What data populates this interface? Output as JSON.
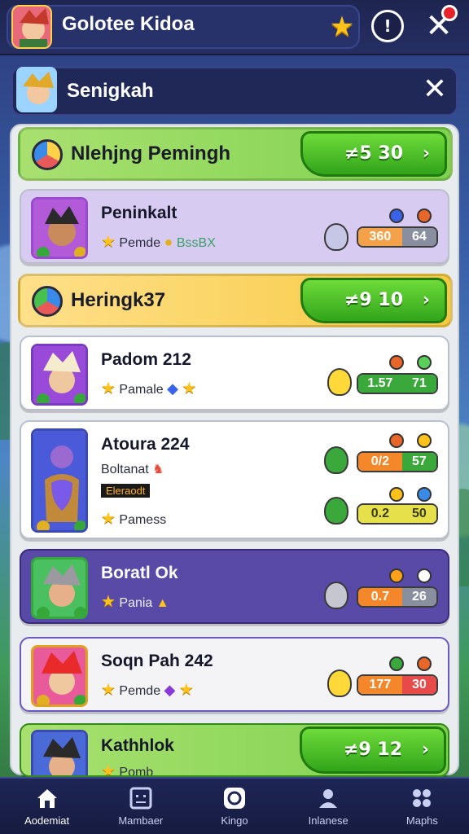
{
  "header": {
    "title": "Golotee Kidoa",
    "icons": [
      "star-icon",
      "info-icon",
      "close-icon"
    ]
  },
  "subheader": {
    "title": "Senigkah"
  },
  "sections": [
    {
      "label": "Nlehjng Pemingh",
      "button": "≠5 30",
      "chevron": "›",
      "color": "#7fd24f"
    },
    {
      "label": "Heringk37",
      "button": "≠9 10",
      "chevron": "›",
      "color": "#f6c940"
    },
    {
      "label": "Kathhlok",
      "button": "≠9 12",
      "chevron": "›",
      "color": "#7fd24f"
    }
  ],
  "cards": [
    {
      "name": "Peninkalt",
      "sub1": "Pemde",
      "sub1b": "BssBX",
      "stat_a": "360",
      "stat_b": "64",
      "mini_a": "ʔ",
      "bg": "#d8cbf2"
    },
    {
      "name": "Padom 212",
      "sub1": "Pamale",
      "stat_a": "1.57",
      "stat_b": "71",
      "bg": "#ffffff"
    },
    {
      "name": "Atoura 224",
      "sub1": "Boltanat",
      "tag": "Eleraodt",
      "sub2": "Pamess",
      "stat_a": "0/2",
      "stat_b": "57",
      "stat_c": "0.2",
      "stat_d": "50",
      "bg": "#ffffff"
    },
    {
      "name": "Boratl Ok",
      "sub1": "Pania",
      "stat_a": "0.7",
      "stat_b": "26",
      "bg": "#5a4aa8"
    },
    {
      "name": "Soqn Pah 242",
      "sub1": "Pemde",
      "stat_a": "177",
      "stat_b": "30",
      "bg": "#f4f4f6"
    },
    {
      "name": "Kathhlok",
      "sub1": "Pomb",
      "bg": "#7fd24f"
    }
  ],
  "nav": [
    {
      "label": "Aodemiat",
      "icon": "home-icon",
      "active": true
    },
    {
      "label": "Mambaer",
      "icon": "face-icon",
      "active": false
    },
    {
      "label": "Kingo",
      "icon": "ring-icon",
      "active": false
    },
    {
      "label": "Inlanese",
      "icon": "person-icon",
      "active": false
    },
    {
      "label": "Maphs",
      "icon": "grid-icon",
      "active": false
    }
  ]
}
